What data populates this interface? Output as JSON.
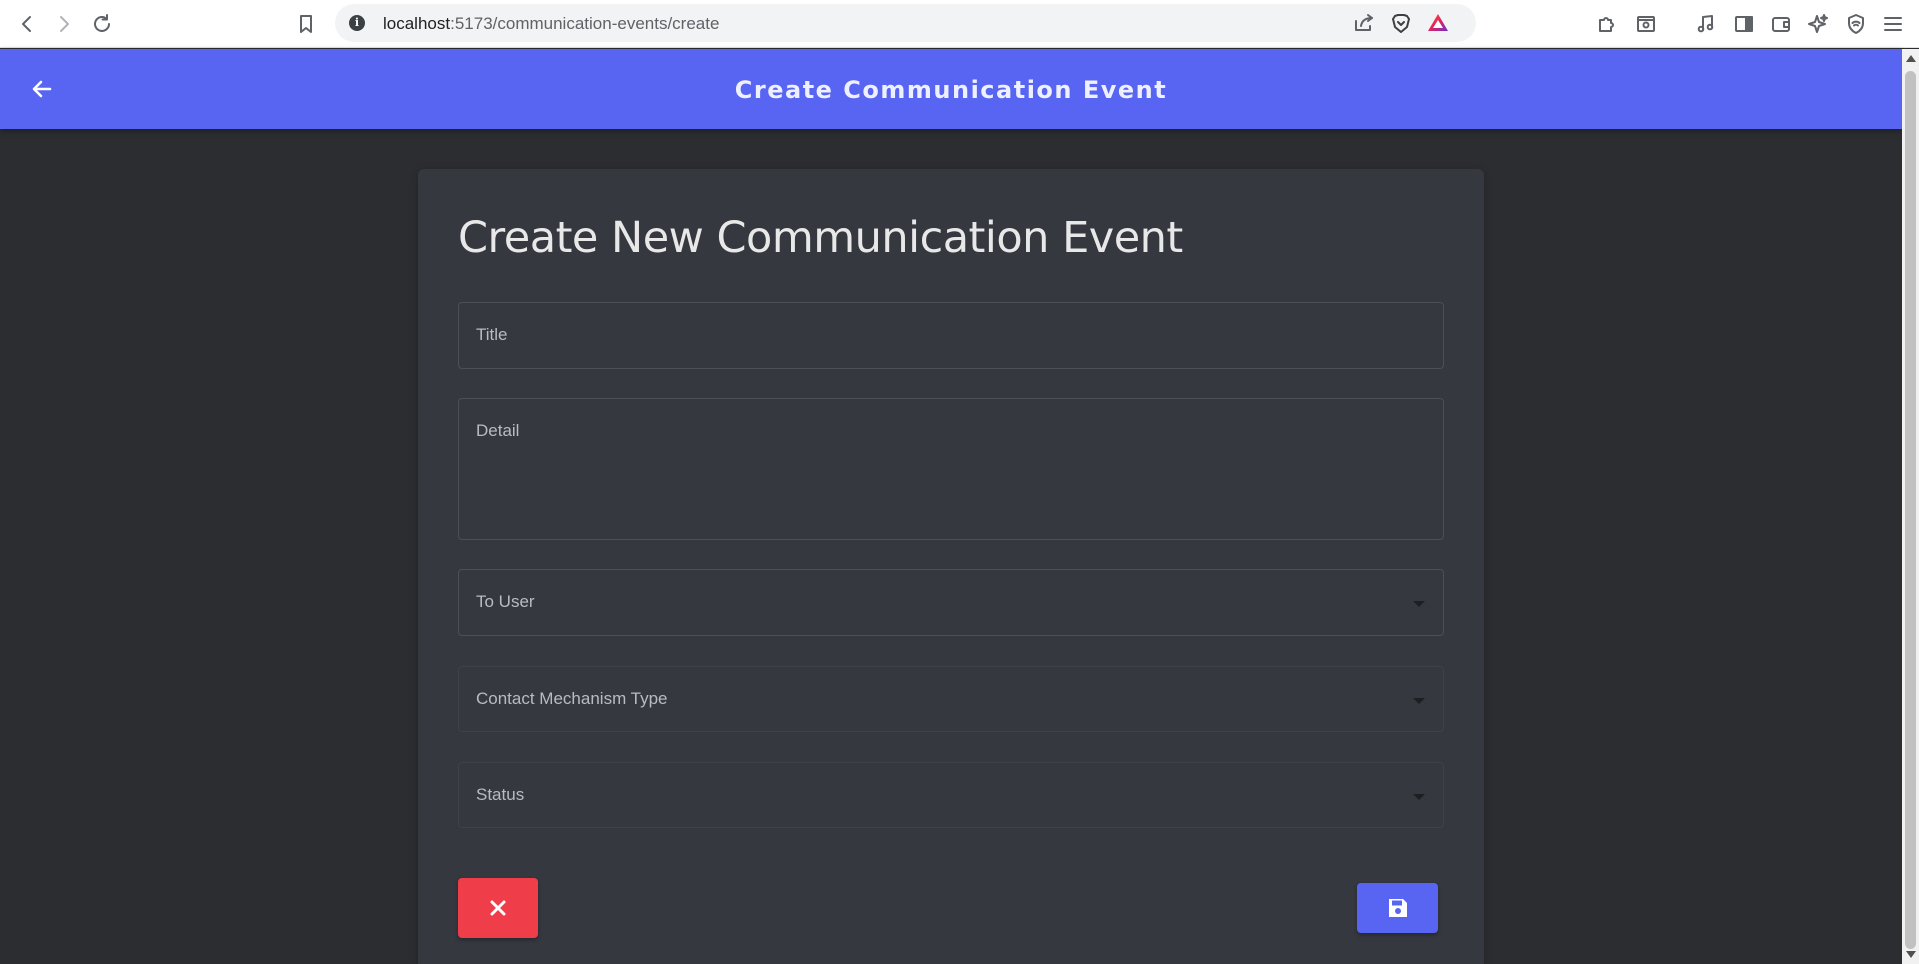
{
  "browser": {
    "url_host": "localhost",
    "url_path": ":5173/communication-events/create"
  },
  "appbar": {
    "title": "Create Communication Event"
  },
  "form": {
    "heading": "Create New Communication Event",
    "fields": {
      "title": {
        "label": "Title",
        "value": ""
      },
      "detail": {
        "label": "Detail",
        "value": ""
      },
      "to_user": {
        "label": "To User",
        "selected": ""
      },
      "contact_mechanism_type": {
        "label": "Contact Mechanism Type",
        "selected": ""
      },
      "status": {
        "label": "Status",
        "selected": ""
      }
    },
    "buttons": {
      "cancel_icon": "close-icon",
      "save_icon": "floppy-disk-icon"
    }
  },
  "colors": {
    "appbar": "#5865f2",
    "background": "#2b2d31",
    "card": "#363840",
    "cancel": "#ef3e4a",
    "save": "#5865f2"
  }
}
